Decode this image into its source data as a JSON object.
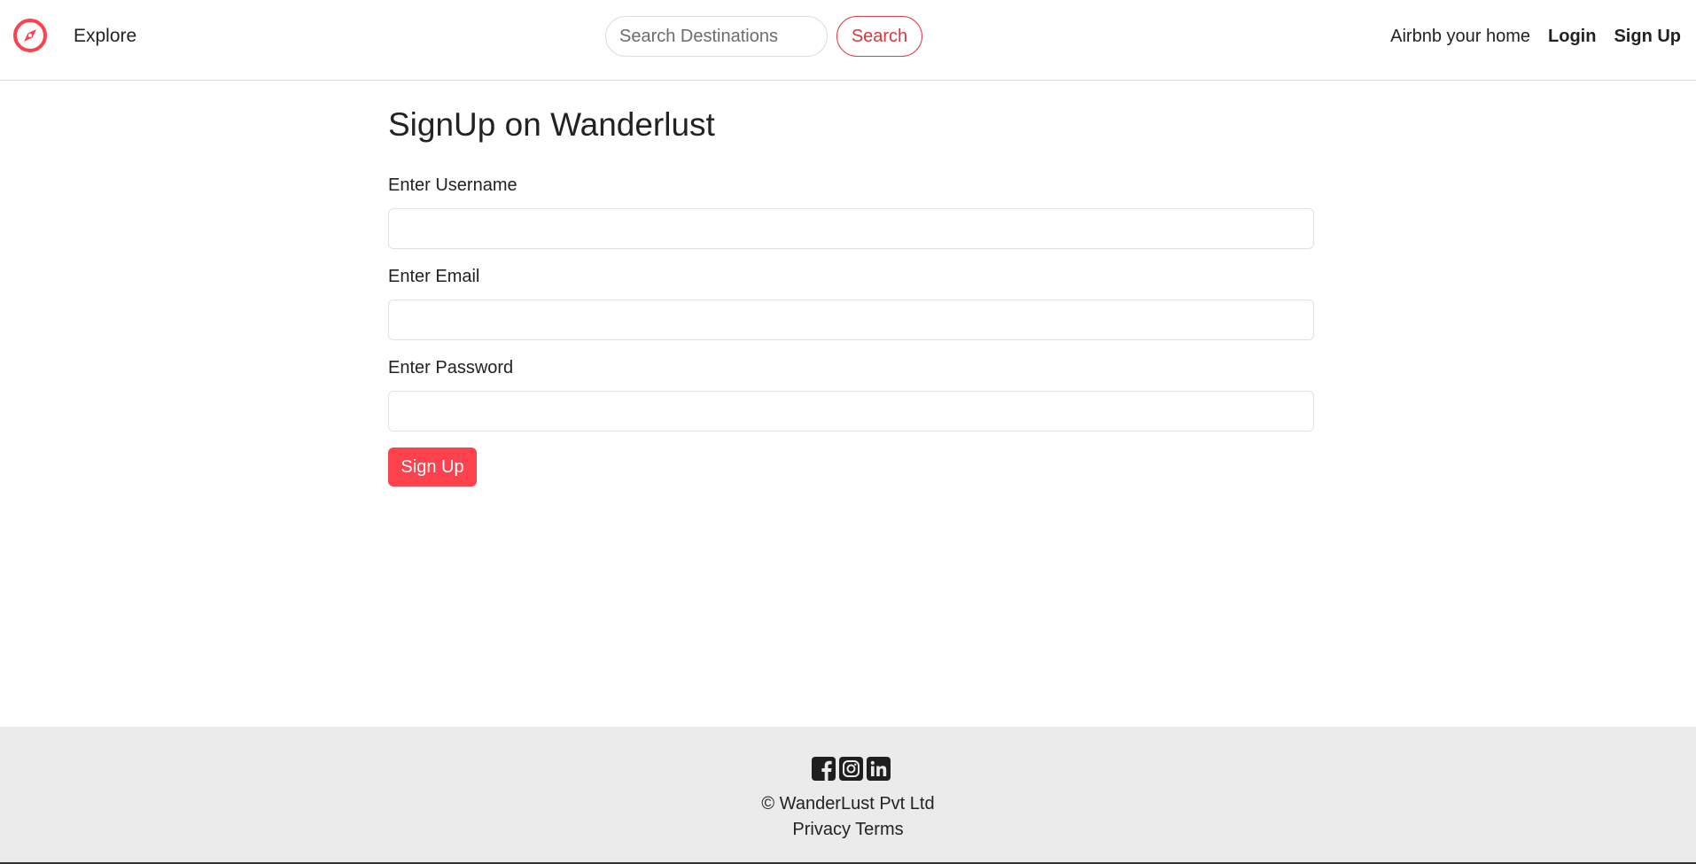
{
  "colors": {
    "brand": "#fe424d",
    "search_accent": "#d9363e",
    "footer_bg": "#ebebeb"
  },
  "navbar": {
    "logo_icon": "compass-icon",
    "explore_label": "Explore",
    "search": {
      "placeholder": "Search Destinations",
      "value": "",
      "button_label": "Search"
    },
    "links": {
      "host": "Airbnb your home",
      "login": "Login",
      "signup": "Sign Up"
    }
  },
  "form": {
    "title": "SignUp on Wanderlust",
    "username_label": "Enter Username",
    "username_value": "",
    "email_label": "Enter Email",
    "email_value": "",
    "password_label": "Enter Password",
    "password_value": "",
    "submit_label": "Sign Up"
  },
  "footer": {
    "social_icons": [
      "facebook-icon",
      "instagram-icon",
      "linkedin-icon"
    ],
    "copyright": "© WanderLust Pvt Ltd",
    "privacy": "Privacy",
    "terms": "Terms"
  }
}
